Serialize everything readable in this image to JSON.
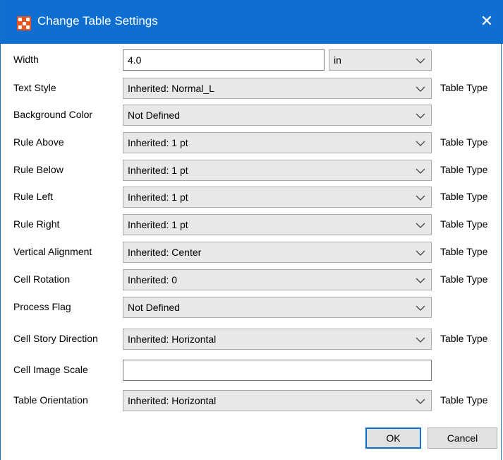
{
  "window": {
    "title": "Change Table Settings",
    "close_glyph": "✕",
    "app_icon": "app-grid-icon"
  },
  "width": {
    "label": "Width",
    "value": "4.0",
    "unit": "in"
  },
  "rows": [
    {
      "label": "Text Style",
      "value": "Inherited: Normal_L",
      "suffix": "Table Type"
    },
    {
      "label": "Background Color",
      "value": "Not Defined",
      "suffix": ""
    },
    {
      "label": "Rule Above",
      "value": "Inherited: 1 pt",
      "suffix": "Table Type"
    },
    {
      "label": "Rule Below",
      "value": "Inherited: 1 pt",
      "suffix": "Table Type"
    },
    {
      "label": "Rule Left",
      "value": "Inherited: 1 pt",
      "suffix": "Table Type"
    },
    {
      "label": "Rule Right",
      "value": "Inherited: 1 pt",
      "suffix": "Table Type"
    },
    {
      "label": "Vertical Alignment",
      "value": "Inherited: Center",
      "suffix": "Table Type"
    },
    {
      "label": "Cell Rotation",
      "value": "Inherited: 0",
      "suffix": "Table Type"
    },
    {
      "label": "Process Flag",
      "value": "Not Defined",
      "suffix": ""
    },
    {
      "label": "Cell Story Direction",
      "value": "Inherited: Horizontal",
      "suffix": "Table Type"
    }
  ],
  "image_scale": {
    "label": "Cell Image Scale",
    "value": ""
  },
  "orientation": {
    "label": "Table Orientation",
    "value": "Inherited: Horizontal",
    "suffix": "Table Type"
  },
  "buttons": {
    "ok": "OK",
    "cancel": "Cancel"
  },
  "colors": {
    "titlebar": "#0f6fd0",
    "icon": "#e8541e",
    "dropdown_bg": "#e8e8e8"
  }
}
